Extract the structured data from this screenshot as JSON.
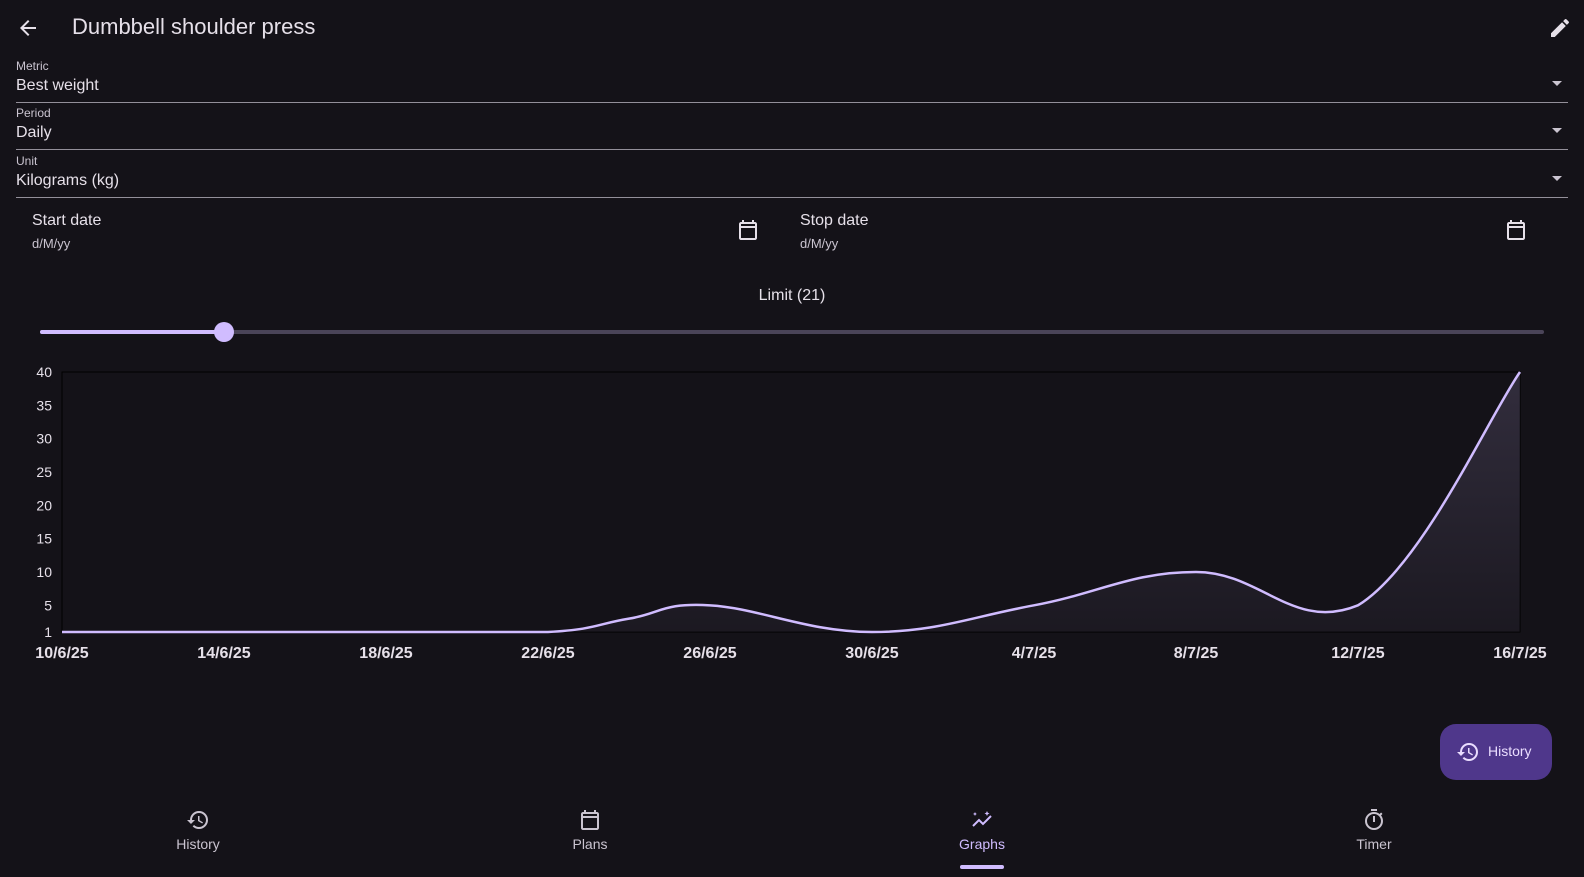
{
  "appbar": {
    "title": "Dumbbell shoulder press",
    "back_icon": "arrow-back-icon",
    "edit_icon": "pencil-icon"
  },
  "fields": {
    "metric": {
      "label": "Metric",
      "value": "Best weight"
    },
    "period": {
      "label": "Period",
      "value": "Daily"
    },
    "unit": {
      "label": "Unit",
      "value": "Kilograms (kg)"
    }
  },
  "dates": {
    "start": {
      "label": "Start date",
      "placeholder": "d/M/yy",
      "icon": "calendar-icon"
    },
    "stop": {
      "label": "Stop date",
      "placeholder": "d/M/yy",
      "icon": "calendar-icon"
    }
  },
  "limit": {
    "label": "Limit (21)",
    "value": 21,
    "min": 10,
    "max": 100
  },
  "chart_data": {
    "type": "area",
    "title": "",
    "xlabel": "",
    "ylabel": "",
    "x": [
      "10/6/25",
      "14/6/25",
      "18/6/25",
      "22/6/25",
      "24/6/25",
      "26/6/25",
      "30/6/25",
      "4/7/25",
      "8/7/25",
      "12/7/25",
      "16/7/25"
    ],
    "values": [
      1,
      1,
      1,
      1,
      3,
      5,
      1,
      5,
      10,
      5,
      40
    ],
    "x_ticks": [
      "10/6/25",
      "14/6/25",
      "18/6/25",
      "22/6/25",
      "26/6/25",
      "30/6/25",
      "4/7/25",
      "8/7/25",
      "12/7/25",
      "16/7/25"
    ],
    "y_ticks": [
      1,
      5,
      10,
      15,
      20,
      25,
      30,
      35,
      40
    ],
    "ylim": [
      1,
      40
    ],
    "line_color": "#d0bcff"
  },
  "fab": {
    "label": "History",
    "icon": "history-icon"
  },
  "nav": {
    "items": [
      {
        "label": "History",
        "icon": "history-icon"
      },
      {
        "label": "Plans",
        "icon": "calendar-icon"
      },
      {
        "label": "Graphs",
        "icon": "graph-icon"
      },
      {
        "label": "Timer",
        "icon": "timer-icon"
      }
    ],
    "active": "Graphs"
  },
  "colors": {
    "background": "#141218",
    "accent": "#d0bcff",
    "fab": "#4f378b"
  }
}
